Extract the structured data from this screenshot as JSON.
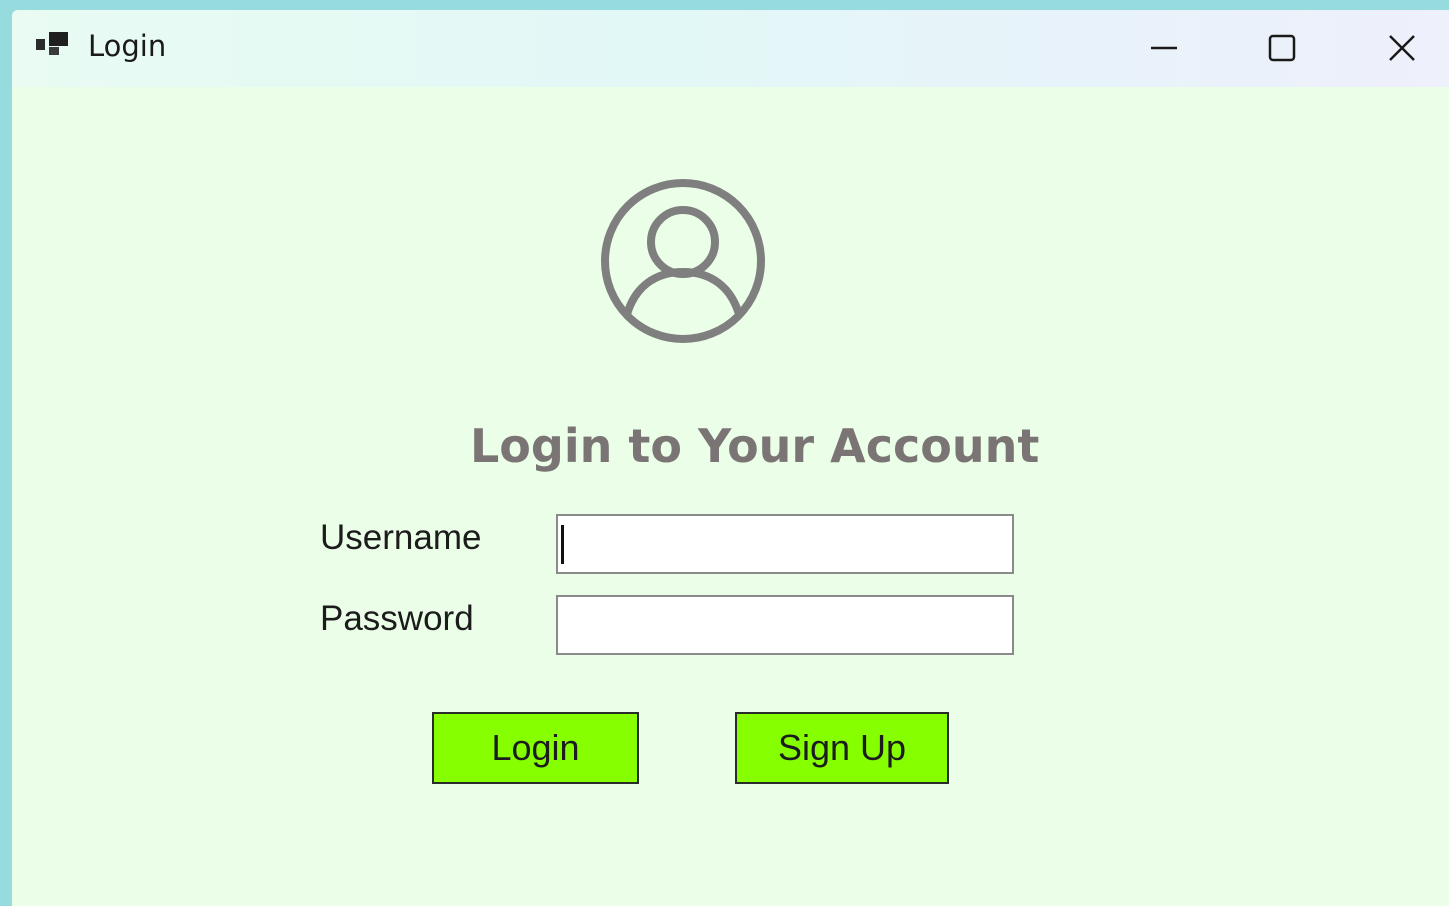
{
  "window": {
    "title": "Login",
    "controls": {
      "minimize": "minimize-icon",
      "maximize": "maximize-icon",
      "close": "close-icon"
    }
  },
  "form": {
    "avatar_icon": "user-circle-icon",
    "heading": "Login to Your Account",
    "username_label": "Username",
    "username_value": "",
    "password_label": "Password",
    "password_value": "",
    "login_button": "Login",
    "signup_button": "Sign Up"
  },
  "colors": {
    "background": "#ebffe8",
    "outer_frame": "#96dcdf",
    "heading": "#7b7474",
    "button_fill": "#86ff00",
    "avatar_stroke": "#7f7f7f"
  }
}
